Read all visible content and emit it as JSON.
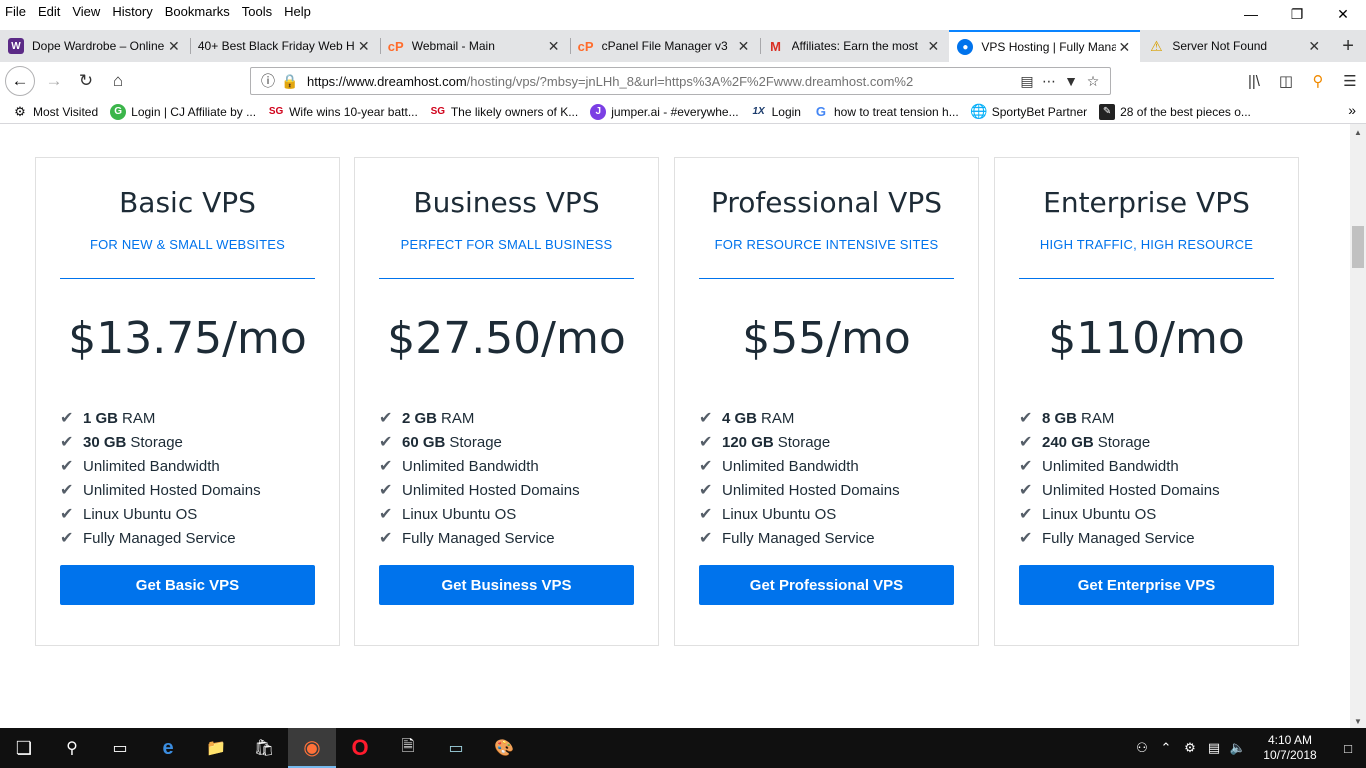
{
  "menubar": {
    "items": [
      "File",
      "Edit",
      "View",
      "History",
      "Bookmarks",
      "Tools",
      "Help"
    ]
  },
  "tabs": [
    {
      "title": "Dope Wardrobe – Online",
      "icon": "wardrobe-favicon",
      "color": "#5b2a86"
    },
    {
      "title": "40+ Best Black Friday Web H",
      "icon": "",
      "color": ""
    },
    {
      "title": "Webmail - Main",
      "icon": "cpanel-icon",
      "color": "#ff6c2c"
    },
    {
      "title": "cPanel File Manager v3",
      "icon": "cpanel-icon",
      "color": "#ff6c2c"
    },
    {
      "title": "Affiliates: Earn the most",
      "icon": "gmail-icon",
      "color": "#d93025"
    },
    {
      "title": "VPS Hosting | Fully Mana",
      "icon": "dreamhost-icon",
      "color": "#0073ec",
      "active": true
    },
    {
      "title": "Server Not Found",
      "icon": "warning-icon",
      "color": "#ffbf00"
    }
  ],
  "navbar": {
    "url_host": "https://www.dreamhost.com",
    "url_path": "/hosting/vps/?mbsy=jnLHh_8&url=https%3A%2F%2Fwww.dreamhost.com%2"
  },
  "bookmarks": [
    {
      "label": "Most Visited",
      "icon": "gear-icon"
    },
    {
      "label": "Login | CJ Affiliate by ...",
      "icon": "cj-icon"
    },
    {
      "label": "Wife wins 10-year batt...",
      "icon": "sg-icon"
    },
    {
      "label": "The likely owners of K...",
      "icon": "sg-icon"
    },
    {
      "label": "jumper.ai - #everywhe...",
      "icon": "jumper-icon"
    },
    {
      "label": "Login",
      "icon": "1x-icon"
    },
    {
      "label": "how to treat tension h...",
      "icon": "google-icon"
    },
    {
      "label": "SportyBet Partner",
      "icon": "globe-icon"
    },
    {
      "label": "28 of the best pieces o...",
      "icon": "page-icon"
    }
  ],
  "plans": [
    {
      "name": "Basic VPS",
      "subtitle": "FOR NEW & SMALL WEBSITES",
      "price": "$13.75/mo",
      "ram": "1 GB",
      "storage": "30 GB",
      "button": "Get Basic VPS"
    },
    {
      "name": "Business VPS",
      "subtitle": "PERFECT FOR SMALL BUSINESS",
      "price": "$27.50/mo",
      "ram": "2 GB",
      "storage": "60 GB",
      "button": "Get Business VPS"
    },
    {
      "name": "Professional VPS",
      "subtitle": "FOR RESOURCE INTENSIVE SITES",
      "price": "$55/mo",
      "ram": "4 GB",
      "storage": "120 GB",
      "button": "Get Professional VPS"
    },
    {
      "name": "Enterprise VPS",
      "subtitle": "HIGH TRAFFIC, HIGH RESOURCE",
      "price": "$110/mo",
      "ram": "8 GB",
      "storage": "240 GB",
      "button": "Get Enterprise VPS"
    }
  ],
  "features": {
    "ram_label": "RAM",
    "storage_label": "Storage",
    "bandwidth": "Unlimited Bandwidth",
    "domains": "Unlimited Hosted Domains",
    "os": "Linux Ubuntu OS",
    "managed": "Fully Managed Service"
  },
  "taskbar": {
    "time": "4:10 AM",
    "date": "10/7/2018"
  },
  "colors": {
    "accent": "#0073ec",
    "tab_active": "#0a84ff"
  }
}
